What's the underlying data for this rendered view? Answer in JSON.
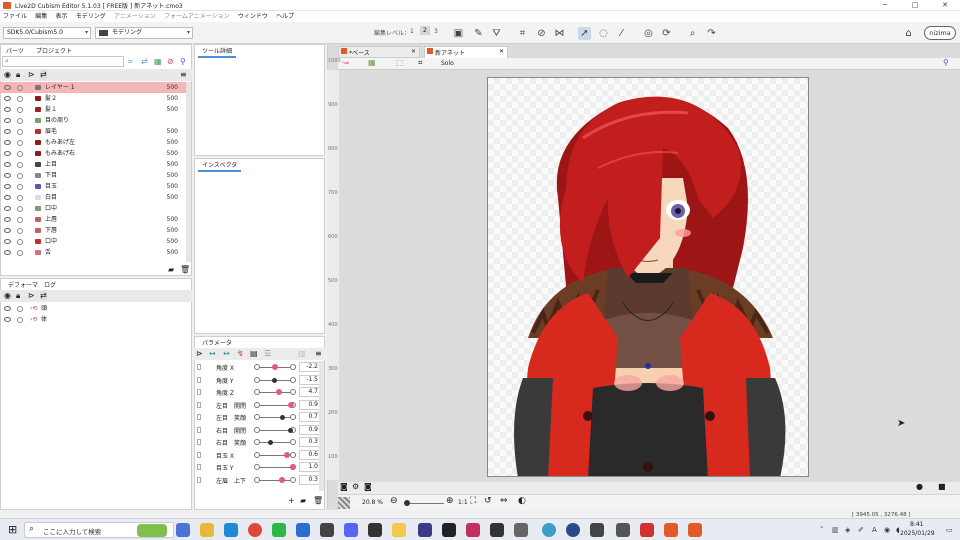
{
  "window": {
    "title": "Live2D Cubism Editor 5.1.03   [ FREE版 ]   新アネット.cmo3",
    "minimize": "─",
    "maximize": "□",
    "close": "✕"
  },
  "menu": [
    "ファイル",
    "編集",
    "表示",
    "モデリング",
    "アニメーション",
    "フォームアニメーション",
    "ウィンドウ",
    "ヘルプ"
  ],
  "toolbar": {
    "sdk_select": "SDK5.0/Cubism5.0",
    "mode_select": "モデリング",
    "edit_level_label": "編集レベル：",
    "levels": [
      "1",
      "2",
      "3"
    ],
    "nizima": "nizima"
  },
  "parts_panel": {
    "tabs": [
      "パーツ",
      "プロジェクト"
    ],
    "rows": [
      {
        "name": "レイヤー 1",
        "value": "500",
        "color": "#777777"
      },
      {
        "name": "髪２",
        "value": "500",
        "color": "#8b1a1a"
      },
      {
        "name": "髪１",
        "value": "500",
        "color": "#a01f1f"
      },
      {
        "name": "目の周り",
        "value": "",
        "color": "#7aa06a"
      },
      {
        "name": "眉毛",
        "value": "500",
        "color": "#b43030"
      },
      {
        "name": "もみあげ左",
        "value": "500",
        "color": "#8b1a1a"
      },
      {
        "name": "もみあげ右",
        "value": "500",
        "color": "#8b1a1a"
      },
      {
        "name": "上目",
        "value": "500",
        "color": "#444444"
      },
      {
        "name": "下目",
        "value": "500",
        "color": "#888888"
      },
      {
        "name": "目玉",
        "value": "500",
        "color": "#5a5ab4"
      },
      {
        "name": "白目",
        "value": "500",
        "color": "#dddddd"
      },
      {
        "name": "口中",
        "value": "",
        "color": "#7aa06a"
      },
      {
        "name": "上唇",
        "value": "500",
        "color": "#c06060"
      },
      {
        "name": "下唇",
        "value": "500",
        "color": "#c06060"
      },
      {
        "name": "口中",
        "value": "500",
        "color": "#c03030"
      },
      {
        "name": "舌",
        "value": "500",
        "color": "#d07080"
      }
    ]
  },
  "deformer_panel": {
    "tabs": [
      "デフォーマ",
      "ログ"
    ],
    "rows": [
      {
        "name": "頭"
      },
      {
        "name": "体"
      }
    ]
  },
  "tool_detail_panel": {
    "tab": "ツール詳細"
  },
  "inspector_panel": {
    "tab": "インスペクタ"
  },
  "parameter_panel": {
    "tab": "パラメータ",
    "rows": [
      {
        "name": "角度 X",
        "value": "-2.2",
        "pos": 0.45,
        "pink": true
      },
      {
        "name": "角度 Y",
        "value": "-1.5",
        "pos": 0.45,
        "pink": false
      },
      {
        "name": "角度 Z",
        "value": "4.7",
        "pos": 0.55,
        "pink": true
      },
      {
        "name": "左目　開閉",
        "value": "0.9",
        "pos": 0.95,
        "pink": true
      },
      {
        "name": "左目　笑顔",
        "value": "0.7",
        "pos": 0.7,
        "pink": false
      },
      {
        "name": "右目　開閉",
        "value": "0.9",
        "pos": 0.95,
        "pink": false
      },
      {
        "name": "右目　笑顔",
        "value": "0.3",
        "pos": 0.3,
        "pink": false
      },
      {
        "name": "目玉 X",
        "value": "0.6",
        "pos": 0.8,
        "pink": true
      },
      {
        "name": "目玉 Y",
        "value": "1.0",
        "pos": 1.0,
        "pink": true
      },
      {
        "name": "左眉　上下",
        "value": "0.3",
        "pos": 0.65,
        "pink": true
      }
    ]
  },
  "canvas": {
    "tabs": [
      {
        "label": "*ベース",
        "close": "✕"
      },
      {
        "label": "新アネット",
        "close": "✕"
      }
    ],
    "view_label": "Solo",
    "ruler_left": [
      "1000",
      "900",
      "800",
      "700",
      "600",
      "500",
      "400",
      "300",
      "200",
      "100"
    ],
    "zoom": "20.8 %",
    "ratio": "1:1",
    "coords": "[ 3945.05 , 3276.48 ]"
  },
  "taskbar": {
    "search_placeholder": "ここに入力して検索",
    "time": "8:41",
    "date": "2025/01/29",
    "ime": "A"
  },
  "colors": {
    "accent": "#4a90d9",
    "selected_row": "#f4b6b6",
    "param_knob": "#e65b78",
    "hair": "#c21e1e",
    "jacket": "#d8291e"
  }
}
